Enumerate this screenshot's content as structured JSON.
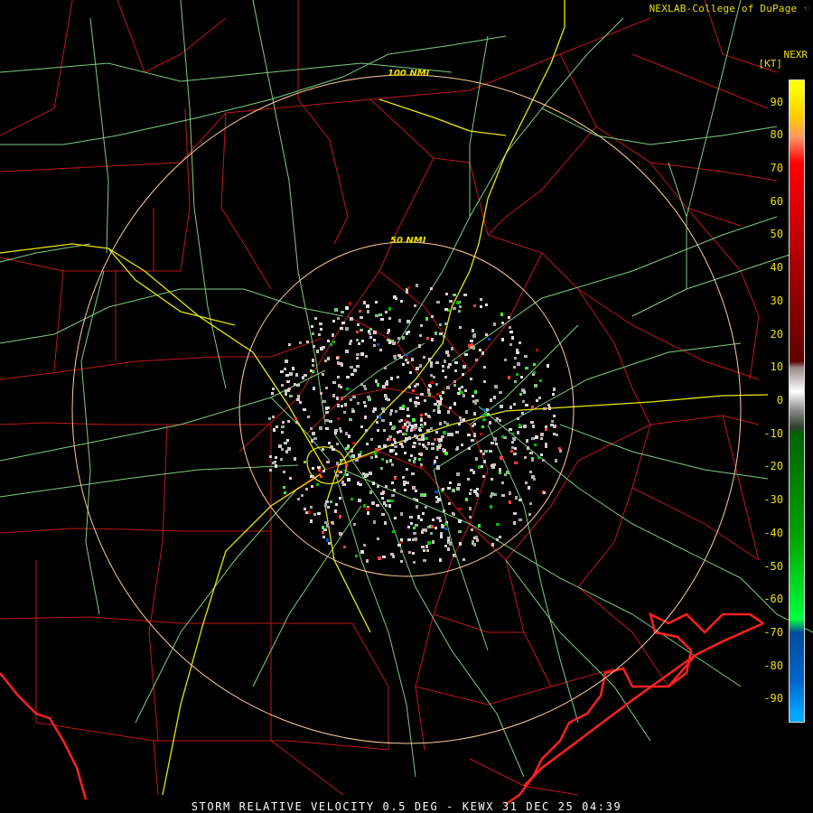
{
  "header": {
    "credit": "NEXLAB-College of DuPage",
    "product_code": "NEXR",
    "units": "[KT]"
  },
  "rings": [
    {
      "label": "100 NMI"
    },
    {
      "label": "50 NMI"
    }
  ],
  "footer": {
    "caption": "STORM RELATIVE VELOCITY 0.5 DEG - KEWX 31 DEC 25 04:39"
  },
  "color_scale": {
    "labels": [
      "90",
      "80",
      "70",
      "60",
      "50",
      "40",
      "30",
      "20",
      "10",
      "0",
      "-10",
      "-20",
      "-30",
      "-40",
      "-50",
      "-60",
      "-70",
      "-80",
      "-90"
    ],
    "stops": [
      {
        "v": 95,
        "color": "#ffff00"
      },
      {
        "v": 86,
        "color": "#ffcc00"
      },
      {
        "v": 80,
        "color": "#ff9966"
      },
      {
        "v": 72,
        "color": "#ff0000"
      },
      {
        "v": 60,
        "color": "#e00000"
      },
      {
        "v": 45,
        "color": "#b40000"
      },
      {
        "v": 30,
        "color": "#8c0000"
      },
      {
        "v": 12,
        "color": "#600000"
      },
      {
        "v": 10,
        "color": "#9a8888"
      },
      {
        "v": 3,
        "color": "#ffffff"
      },
      {
        "v": -3,
        "color": "#888888"
      },
      {
        "v": -8,
        "color": "#304030"
      },
      {
        "v": -10,
        "color": "#006400"
      },
      {
        "v": -40,
        "color": "#00a000"
      },
      {
        "v": -66,
        "color": "#00ff40"
      },
      {
        "v": -70,
        "color": "#004c99"
      },
      {
        "v": -85,
        "color": "#0066cc"
      },
      {
        "v": -95,
        "color": "#00aaff"
      }
    ]
  },
  "colors": {
    "county": "#c01818",
    "road_green": "#7fcc7f",
    "interstate": "#e8e800",
    "coast": "#ff2020",
    "ring": "#ffcc99"
  }
}
